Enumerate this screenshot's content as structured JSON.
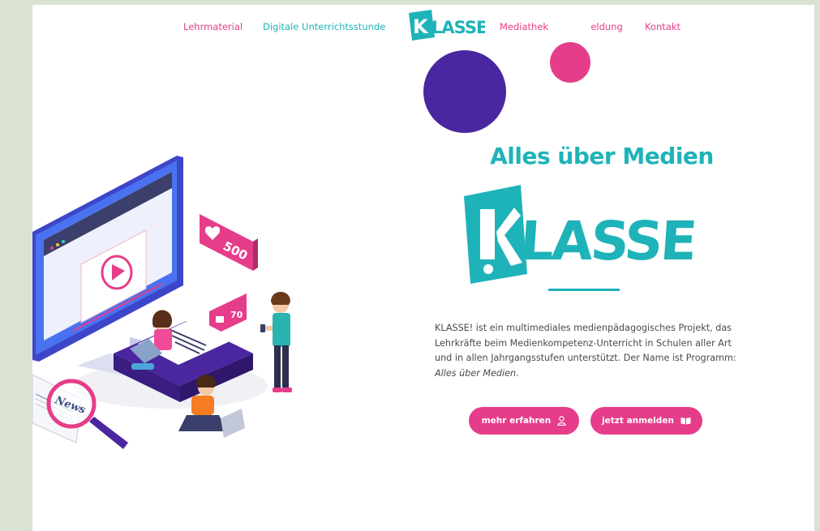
{
  "nav": {
    "items": [
      {
        "label": "Lehrmaterial",
        "color": "#e63d8a"
      },
      {
        "label": "Digitale Unterrichtsstunde",
        "color": "#1eb3b8"
      },
      {
        "label": "Mediathek",
        "color": "#e63d8a"
      },
      {
        "label": "Anmeldung",
        "color": "#e63d8a"
      },
      {
        "label": "Kontakt",
        "color": "#e63d8a"
      }
    ],
    "logo_text": "KLASSE"
  },
  "hero": {
    "tagline": "Alles über Medien",
    "logo_text": "KLASSE",
    "intro_text": "KLASSE! ist ein multimediales medienpädagogisches Projekt, das Lehrkräfte beim Medienkompetenz-Unterricht in Schulen aller Art und in allen Jahrgangsstufen unterstützt. Der Name ist Programm: ",
    "intro_emphasis": "Alles über Medien",
    "intro_end": ".",
    "buttons": {
      "more": {
        "label": "mehr erfahren",
        "icon": "user-icon"
      },
      "signup": {
        "label": "jetzt anmelden",
        "icon": "book-icon"
      }
    }
  },
  "illustration": {
    "like_count": "500",
    "comment_count": "70",
    "newspaper_text": "News"
  },
  "colors": {
    "teal": "#1eb3b8",
    "pink": "#e63d8a",
    "purple": "#4a26a0",
    "page_bg": "#d9e2d3"
  }
}
